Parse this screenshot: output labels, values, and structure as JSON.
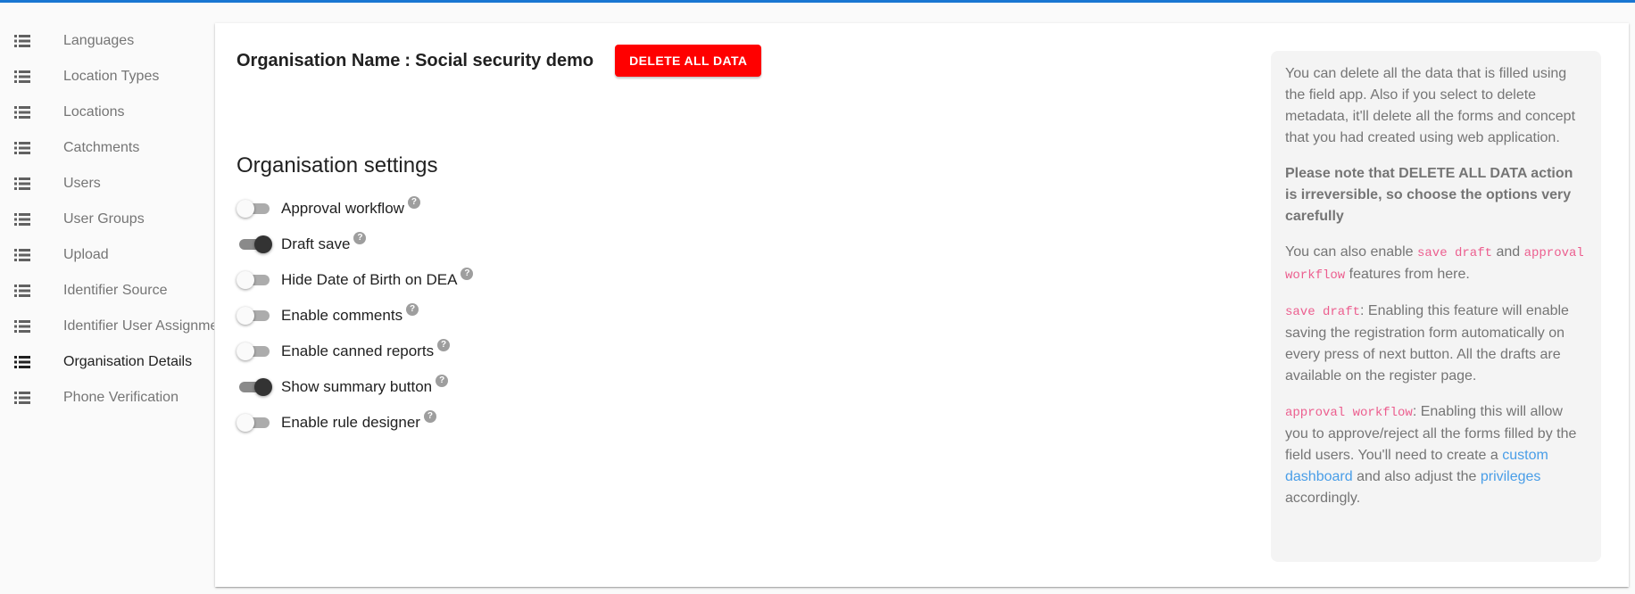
{
  "sidebar": {
    "items": [
      {
        "label": "Languages"
      },
      {
        "label": "Location Types"
      },
      {
        "label": "Locations"
      },
      {
        "label": "Catchments"
      },
      {
        "label": "Users"
      },
      {
        "label": "User Groups"
      },
      {
        "label": "Upload"
      },
      {
        "label": "Identifier Source"
      },
      {
        "label": "Identifier User Assignment"
      },
      {
        "label": "Organisation Details"
      },
      {
        "label": "Phone Verification"
      }
    ],
    "active": "Organisation Details"
  },
  "header": {
    "org_label": "Organisation Name",
    "separator": ":",
    "org_name": "Social security demo",
    "delete_button": "DELETE ALL DATA"
  },
  "settings": {
    "title": "Organisation settings",
    "items": [
      {
        "label": "Approval workflow",
        "enabled": false
      },
      {
        "label": "Draft save",
        "enabled": true
      },
      {
        "label": "Hide Date of Birth on DEA",
        "enabled": false
      },
      {
        "label": "Enable comments",
        "enabled": false
      },
      {
        "label": "Enable canned reports",
        "enabled": false
      },
      {
        "label": "Show summary button",
        "enabled": true
      },
      {
        "label": "Enable rule designer",
        "enabled": false
      }
    ],
    "help_glyph": "?"
  },
  "help_panel": {
    "p1": "You can delete all the data that is filled using the field app. Also if you select to delete metadata, it'll delete all the forms and concept that you had created using web application.",
    "p2": "Please note that DELETE ALL DATA action is irreversible, so choose the options very carefully",
    "p3_pre": "You can also enable ",
    "p3_code1": "save draft",
    "p3_mid": " and ",
    "p3_code2": "approval workflow",
    "p3_post": " features from here.",
    "p4_code": "save draft",
    "p4_text": ": Enabling this feature will enable saving the registration form automatically on every press of next button. All the drafts are available on the register page.",
    "p5_code": "approval workflow",
    "p5_text": ": Enabling this will allow you to approve/reject all the forms filled by the field users. You'll need to create a ",
    "p5_link1": "custom dashboard",
    "p5_mid": " and also adjust the ",
    "p5_link2": "privileges",
    "p5_end": " accordingly."
  },
  "colors": {
    "accent_bar": "#1976d2",
    "delete_button": "#ff0000",
    "code": "#e91e63",
    "link": "#1e88e5"
  },
  "icons": {
    "nav": "list-icon",
    "help": "help-circle-icon"
  }
}
